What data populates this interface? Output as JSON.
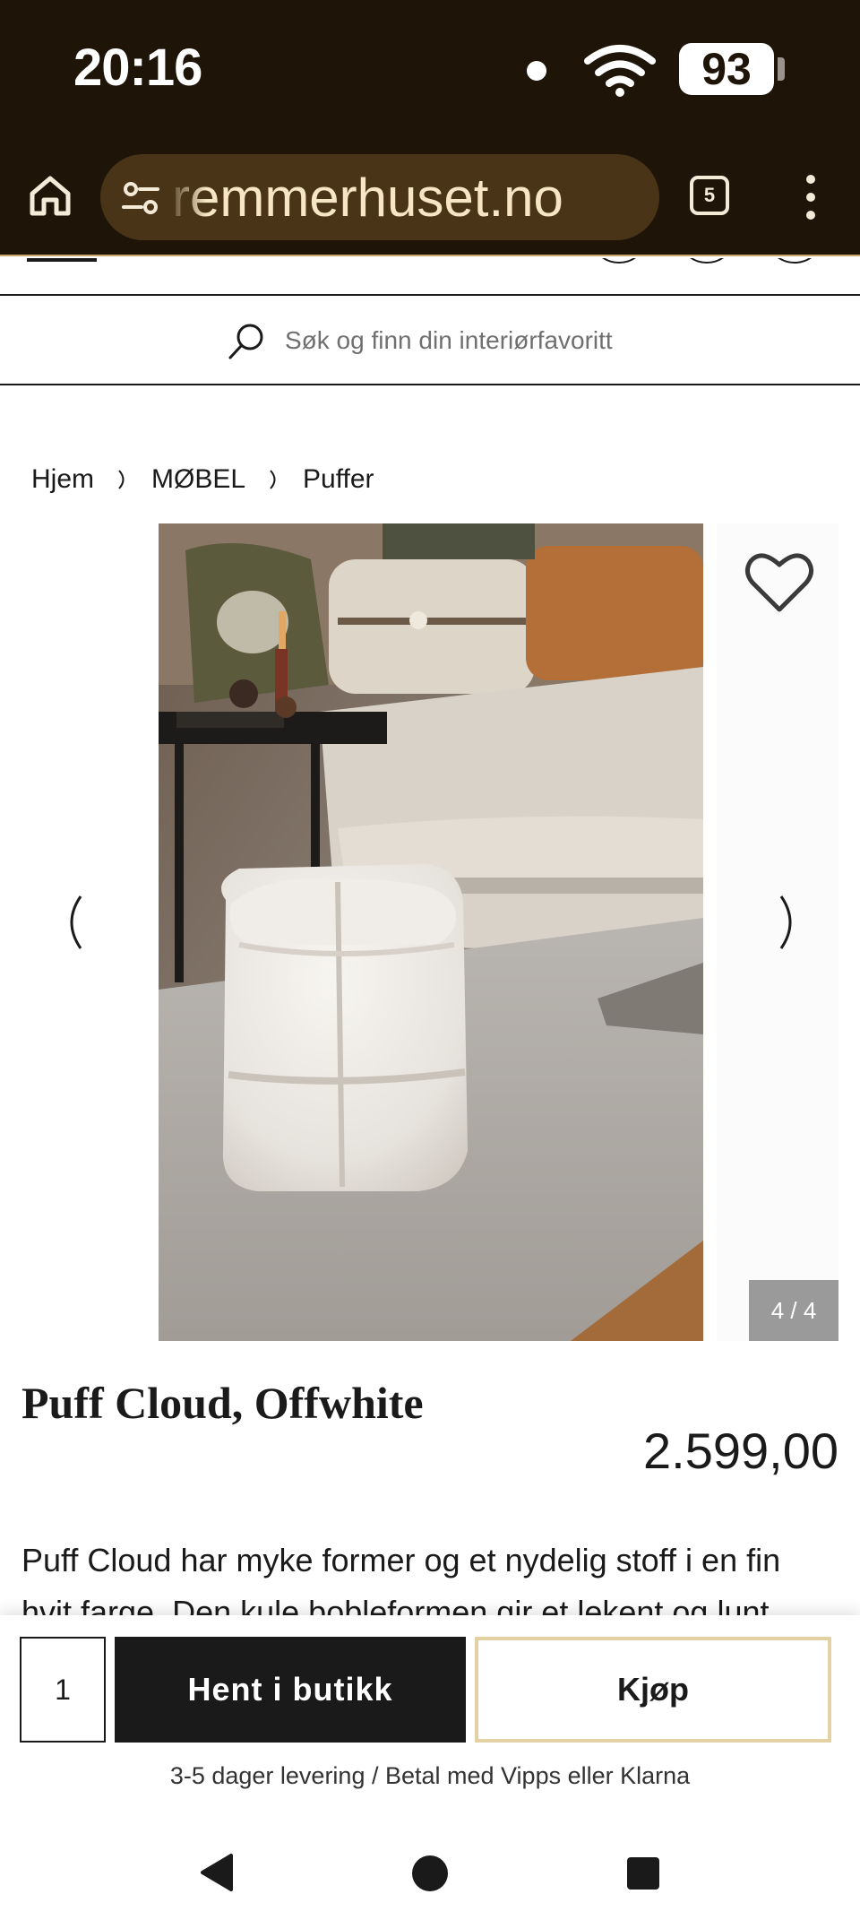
{
  "status_bar": {
    "time": "20:16",
    "battery": "93",
    "icons": [
      "notification-dot-icon",
      "wifi-icon",
      "battery-icon"
    ]
  },
  "browser": {
    "url": "remmerhuset.no",
    "tab_count": "5",
    "icons": [
      "home-icon",
      "site-settings-icon",
      "tabs-icon",
      "overflow-menu-icon"
    ],
    "colors": {
      "toolbar_bg": "#1f1408",
      "url_pill_bg": "#4a3418",
      "url_text": "#f6e6c4",
      "accent_line": "#c9a96a"
    }
  },
  "search": {
    "placeholder": "Søk og finn din interiørfavoritt",
    "value": ""
  },
  "breadcrumb": {
    "items": [
      "Hjem",
      "MØBEL",
      "Puffer"
    ]
  },
  "gallery": {
    "counter": "4 / 4",
    "current_index": 4,
    "total": 4,
    "icons": [
      "heart-icon",
      "chevron-left-icon",
      "chevron-right-icon"
    ]
  },
  "product": {
    "title": "Puff Cloud, Offwhite",
    "price": "2.599,00",
    "description": "Puff Cloud har myke former og et nydelig stoff i en fin hvit farge. Den kule bobleformen gir et lekent og lunt"
  },
  "purchase": {
    "quantity": "1",
    "pickup_label": "Hent i butikk",
    "buy_label": "Kjøp",
    "delivery_note": "3-5 dager levering / Betal med Vipps eller Klarna",
    "colors": {
      "pickup_bg": "#1a1a1a",
      "buy_border": "#e3d1a4"
    }
  },
  "system_nav": {
    "icons": [
      "back-icon",
      "home-circle-icon",
      "recents-icon"
    ]
  }
}
